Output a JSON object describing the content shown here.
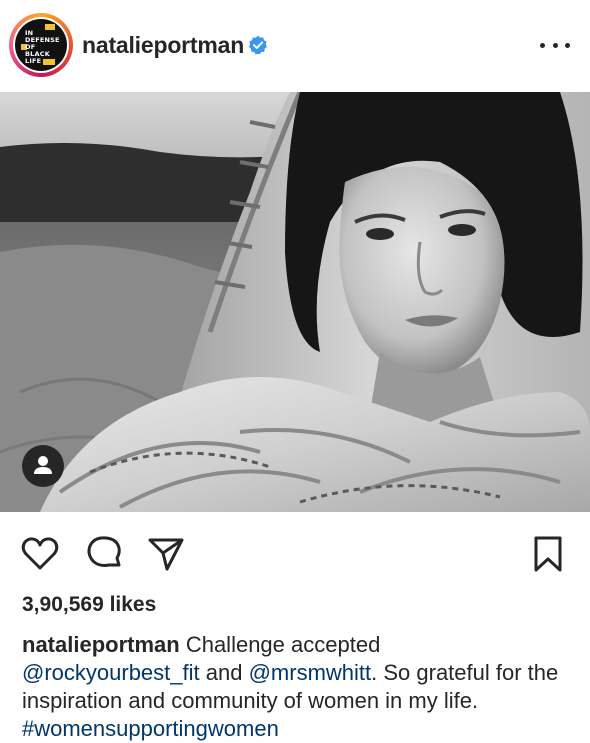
{
  "post": {
    "username": "natalieportman",
    "verified": true,
    "avatar_text": "IN DEFENSE OF BLACK LIFE",
    "avatar_lines": [
      "IN",
      "DEFENSE",
      "OF",
      "BLACK",
      "LIFE"
    ],
    "likes": "3,90,569 likes",
    "caption": {
      "username": "natalieportman",
      "text1": "Challenge accepted",
      "mention1": "@rockyourbest_fit",
      "and": "and",
      "mention2": "@mrsmwhitt",
      "text2": ". So grateful for the inspiration and community of women in my life.",
      "hashtag": "#womensupportingwomen"
    }
  },
  "icons": {
    "more": "more-options-icon",
    "tag": "user-tag-icon",
    "like": "heart-icon",
    "comment": "comment-icon",
    "share": "share-icon",
    "save": "bookmark-icon"
  },
  "colors": {
    "text": "#262626",
    "link": "#00376b",
    "verified": "#3897f0"
  }
}
